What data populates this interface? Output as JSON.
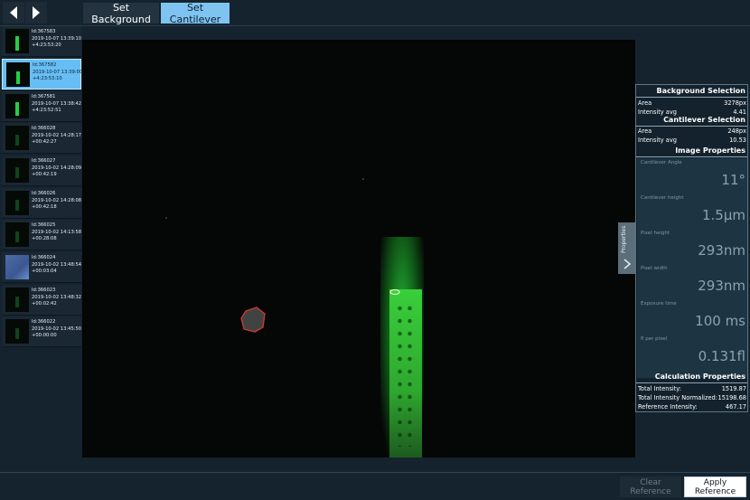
{
  "toolbar": {
    "set_background": "Set Background",
    "set_cantilever": "Set Cantilever"
  },
  "thumbnails": [
    {
      "id": "Id:367583",
      "date": "2019-10-07 13:39:10",
      "offset": "+4:23:53:20",
      "selected": false
    },
    {
      "id": "Id:367582",
      "date": "2019-10-07 13:39:00",
      "offset": "+4:23:53:10",
      "selected": true
    },
    {
      "id": "Id:367581",
      "date": "2019-10-07 13:38:42",
      "offset": "+4:23:52:51",
      "selected": false
    },
    {
      "id": "Id:366028",
      "date": "2019-10-02 14:28:17",
      "offset": "+00:42:27",
      "selected": false
    },
    {
      "id": "Id:366027",
      "date": "2019-10-02 14:28:09",
      "offset": "+00:42:19",
      "selected": false
    },
    {
      "id": "Id:366026",
      "date": "2019-10-02 14:28:08",
      "offset": "+00:42:18",
      "selected": false
    },
    {
      "id": "Id:366025",
      "date": "2019-10-02 14:13:58",
      "offset": "+00:28:08",
      "selected": false
    },
    {
      "id": "Id:366024",
      "date": "2019-10-02 13:48:54",
      "offset": "+00:03:04",
      "selected": false
    },
    {
      "id": "Id:366023",
      "date": "2019-10-02 13:48:32",
      "offset": "+00:02:42",
      "selected": false
    },
    {
      "id": "Id:366022",
      "date": "2019-10-02 13:45:50",
      "offset": "+00:00:00",
      "selected": false
    }
  ],
  "side_handle": {
    "label": "Properties"
  },
  "props": {
    "bg_title": "Background Selection",
    "bg_area_label": "Area",
    "bg_area_value": "3278px",
    "bg_int_label": "Intensity avg",
    "bg_int_value": "4.41",
    "cl_title": "Cantilever Selection",
    "cl_area_label": "Area",
    "cl_area_value": "248px",
    "cl_int_label": "Intensity avg",
    "cl_int_value": "10.53",
    "img_title": "Image Properties",
    "image_properties": [
      {
        "label": "Cantilever Angle",
        "value": "11°"
      },
      {
        "label": "Cantilever height",
        "value": "1.5μm"
      },
      {
        "label": "Pixel height",
        "value": "293nm"
      },
      {
        "label": "Pixel width",
        "value": "293nm"
      },
      {
        "label": "Exposure time",
        "value": "100 ms"
      },
      {
        "label": "fl per pixel",
        "value": "0.131fl"
      }
    ],
    "calc_title": "Calculation Properties",
    "calc": [
      {
        "label": "Total Intensity:",
        "value": "1519.87"
      },
      {
        "label": "Total Intensity Normalized:",
        "value": "15198.68"
      },
      {
        "label": "Reference Intensity:",
        "value": "467.17"
      }
    ]
  },
  "bottom": {
    "clear_reference": "Clear Reference",
    "apply_reference": "Apply Reference"
  }
}
